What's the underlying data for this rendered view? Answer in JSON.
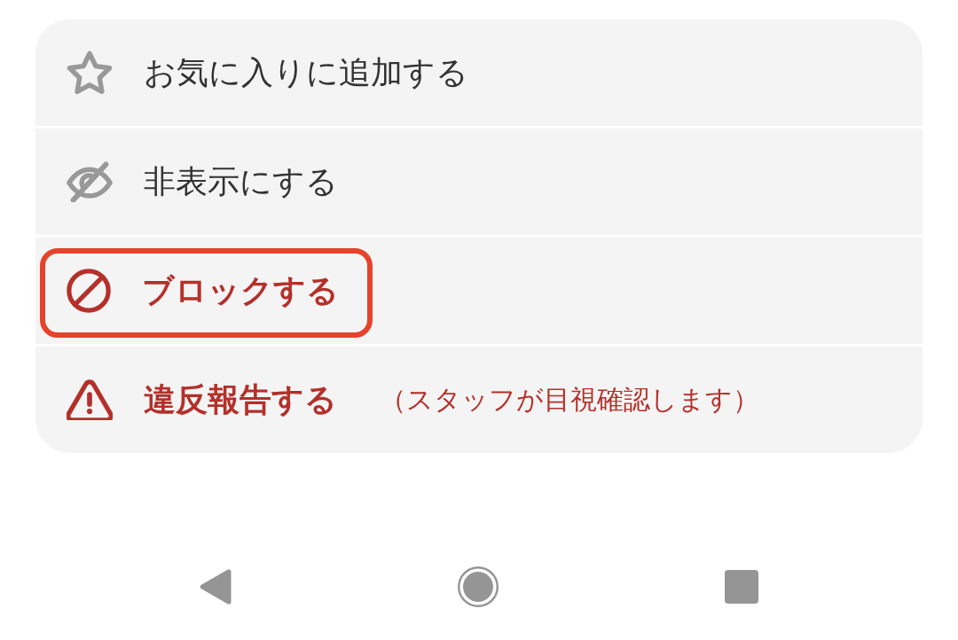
{
  "menu": {
    "items": [
      {
        "kind": "favorite",
        "label": "お気に入りに追加する",
        "destructive": false,
        "highlighted": false
      },
      {
        "kind": "hide",
        "label": "非表示にする",
        "destructive": false,
        "highlighted": false
      },
      {
        "kind": "block",
        "label": "ブロックする",
        "destructive": true,
        "highlighted": true
      },
      {
        "kind": "report",
        "label": "違反報告する",
        "note": "（スタッフが目視確認します）",
        "destructive": true,
        "highlighted": false
      }
    ]
  },
  "nav_bar": {
    "buttons": [
      {
        "kind": "back"
      },
      {
        "kind": "home"
      },
      {
        "kind": "recents"
      }
    ]
  }
}
